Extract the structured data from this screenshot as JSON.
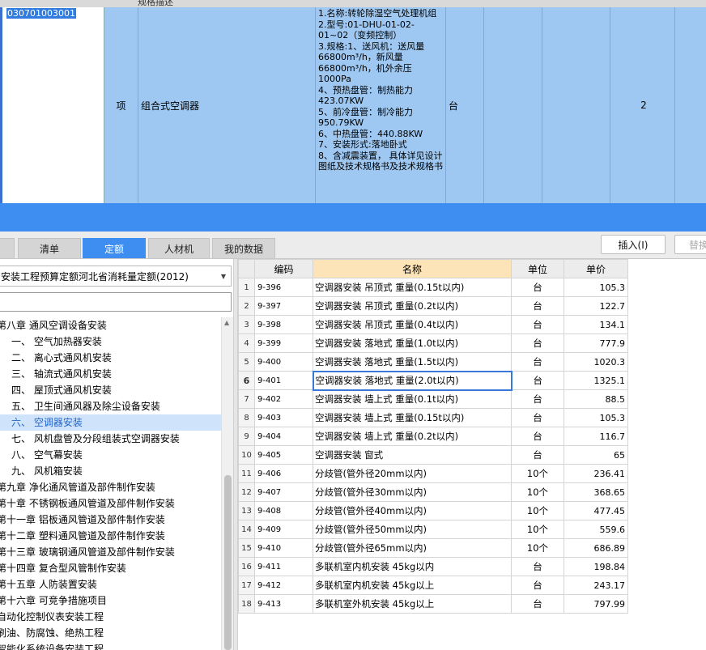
{
  "top": {
    "header_partial": "规格描述",
    "row": {
      "code": "030701003001",
      "type": "项",
      "name": "组合式空调器",
      "description": "1.名称:转轮除湿空气处理机组\n2.型号:01-DHU-01-02-01~02（变频控制）\n3.规格:1、送风机：送风量66800m³/h，新风量66800m³/h，机外余压1000Pa\n4、预热盘管：制热能力423.07KW\n5、前冷盘管：制冷能力950.79KW\n6、中热盘管：440.88KW\n7、安装形式:落地卧式\n8、含减震装置，  具体详见设计图纸及技术规格书及技术规格书",
      "unit": "台",
      "quantity": "2"
    }
  },
  "tabs": [
    {
      "label": "清单",
      "active": false
    },
    {
      "label": "定额",
      "active": true
    },
    {
      "label": "人材机",
      "active": false
    },
    {
      "label": "我的数据",
      "active": false
    }
  ],
  "toolbar": {
    "insert_label": "插入(I)",
    "replace_label": "替换"
  },
  "left": {
    "quota_library": "安装工程预算定额河北省消耗量定额(2012)",
    "search_placeholder": "",
    "tree": [
      {
        "label": "第八章  通风空调设备安装",
        "level": 0,
        "selected": false
      },
      {
        "label": "一、 空气加热器安装",
        "level": 1,
        "selected": false
      },
      {
        "label": "二、 离心式通风机安装",
        "level": 1,
        "selected": false
      },
      {
        "label": "三、 轴流式通风机安装",
        "level": 1,
        "selected": false
      },
      {
        "label": "四、 屋顶式通风机安装",
        "level": 1,
        "selected": false
      },
      {
        "label": "五、 卫生间通风器及除尘设备安装",
        "level": 1,
        "selected": false
      },
      {
        "label": "六、 空调器安装",
        "level": 1,
        "selected": true
      },
      {
        "label": "七、 风机盘管及分段组装式空调器安装",
        "level": 1,
        "selected": false
      },
      {
        "label": "八、 空气幕安装",
        "level": 1,
        "selected": false
      },
      {
        "label": "九、 风机箱安装",
        "level": 1,
        "selected": false
      },
      {
        "label": "第九章  净化通风管道及部件制作安装",
        "level": 0,
        "selected": false
      },
      {
        "label": "第十章  不锈钢板通风管道及部件制作安装",
        "level": 0,
        "selected": false
      },
      {
        "label": "第十一章  铝板通风管道及部件制作安装",
        "level": 0,
        "selected": false
      },
      {
        "label": "第十二章  塑料通风管道及部件制作安装",
        "level": 0,
        "selected": false
      },
      {
        "label": "第十三章  玻璃钢通风管道及部件制作安装",
        "level": 0,
        "selected": false
      },
      {
        "label": "第十四章  复合型风管制作安装",
        "level": 0,
        "selected": false
      },
      {
        "label": "第十五章  人防装置安装",
        "level": 0,
        "selected": false
      },
      {
        "label": "第十六章  可竞争措施项目",
        "level": 0,
        "selected": false
      },
      {
        "label": "自动化控制仪表安装工程",
        "level": 0,
        "selected": false
      },
      {
        "label": "刷油、防腐蚀、绝热工程",
        "level": 0,
        "selected": false
      },
      {
        "label": "智能化系统设备安装工程",
        "level": 0,
        "selected": false
      }
    ]
  },
  "table": {
    "headers": {
      "code": "编码",
      "name": "名称",
      "unit": "单位",
      "price": "单价"
    },
    "current_row": 6,
    "rows": [
      {
        "n": "1",
        "code": "9-396",
        "name": "空调器安装 吊顶式 重量(0.15t以内)",
        "unit": "台",
        "price": "105.3"
      },
      {
        "n": "2",
        "code": "9-397",
        "name": "空调器安装 吊顶式 重量(0.2t以内)",
        "unit": "台",
        "price": "122.7"
      },
      {
        "n": "3",
        "code": "9-398",
        "name": "空调器安装 吊顶式 重量(0.4t以内)",
        "unit": "台",
        "price": "134.1"
      },
      {
        "n": "4",
        "code": "9-399",
        "name": "空调器安装 落地式 重量(1.0t以内)",
        "unit": "台",
        "price": "777.9"
      },
      {
        "n": "5",
        "code": "9-400",
        "name": "空调器安装 落地式 重量(1.5t以内)",
        "unit": "台",
        "price": "1020.3"
      },
      {
        "n": "6",
        "code": "9-401",
        "name": "空调器安装 落地式 重量(2.0t以内)",
        "unit": "台",
        "price": "1325.1"
      },
      {
        "n": "7",
        "code": "9-402",
        "name": "空调器安装 墙上式 重量(0.1t以内)",
        "unit": "台",
        "price": "88.5"
      },
      {
        "n": "8",
        "code": "9-403",
        "name": "空调器安装 墙上式 重量(0.15t以内)",
        "unit": "台",
        "price": "105.3"
      },
      {
        "n": "9",
        "code": "9-404",
        "name": "空调器安装 墙上式 重量(0.2t以内)",
        "unit": "台",
        "price": "116.7"
      },
      {
        "n": "10",
        "code": "9-405",
        "name": "空调器安装 窗式",
        "unit": "台",
        "price": "65"
      },
      {
        "n": "11",
        "code": "9-406",
        "name": "分歧管(管外径20mm以内)",
        "unit": "10个",
        "price": "236.41"
      },
      {
        "n": "12",
        "code": "9-407",
        "name": "分歧管(管外径30mm以内)",
        "unit": "10个",
        "price": "368.65"
      },
      {
        "n": "13",
        "code": "9-408",
        "name": "分歧管(管外径40mm以内)",
        "unit": "10个",
        "price": "477.45"
      },
      {
        "n": "14",
        "code": "9-409",
        "name": "分歧管(管外径50mm以内)",
        "unit": "10个",
        "price": "559.6"
      },
      {
        "n": "15",
        "code": "9-410",
        "name": "分歧管(管外径65mm以内)",
        "unit": "10个",
        "price": "686.89"
      },
      {
        "n": "16",
        "code": "9-411",
        "name": "多联机室内机安装 45kg以内",
        "unit": "台",
        "price": "198.84"
      },
      {
        "n": "17",
        "code": "9-412",
        "name": "多联机室内机安装 45kg以上",
        "unit": "台",
        "price": "243.17"
      },
      {
        "n": "18",
        "code": "9-413",
        "name": "多联机室外机安装 45kg以上",
        "unit": "台",
        "price": "797.99"
      }
    ]
  },
  "colors": {
    "accent": "#3d8ef0",
    "selected_row": "#9ec8f2",
    "name_header": "#fce3b8"
  }
}
